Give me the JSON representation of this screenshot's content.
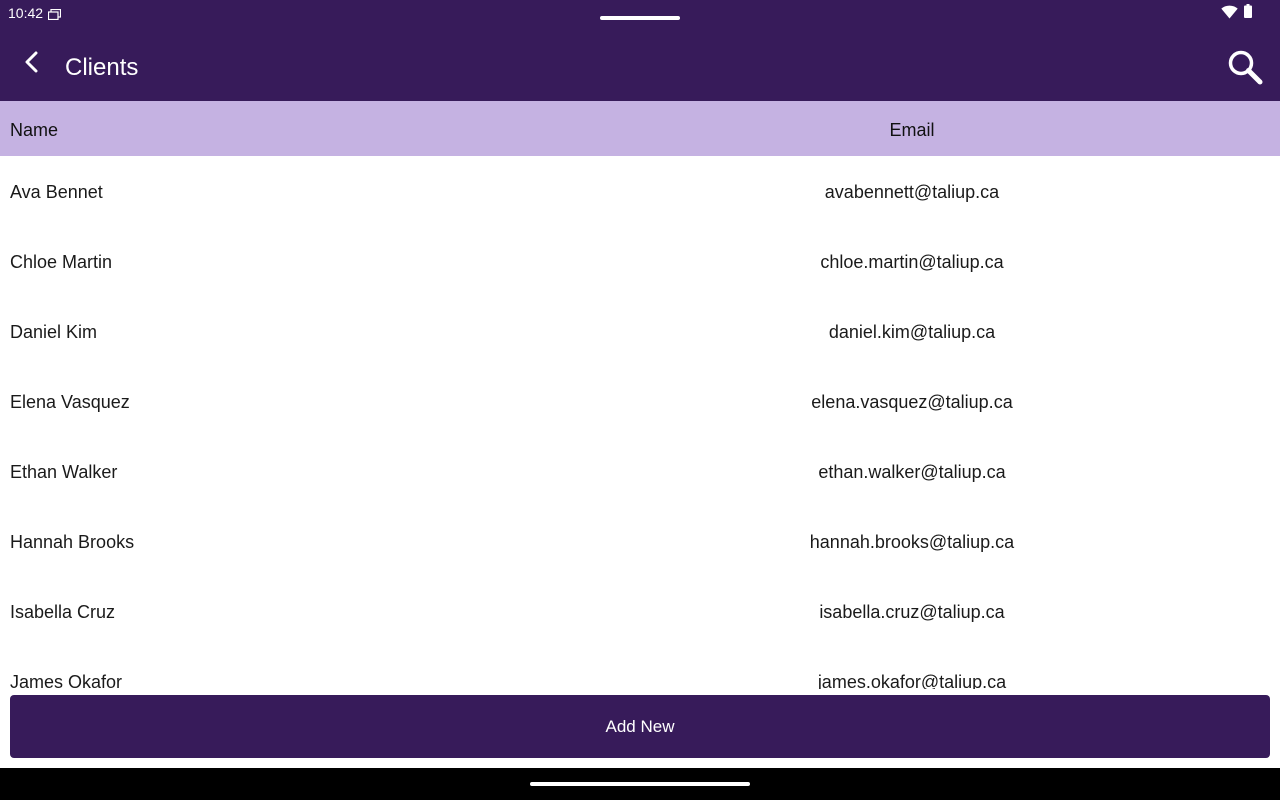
{
  "status_bar": {
    "time": "10:42",
    "icons": [
      "notification-icon",
      "wifi-icon",
      "battery-icon"
    ]
  },
  "app_bar": {
    "title": "Clients",
    "back_icon": "chevron-left-icon",
    "search_icon": "search-icon"
  },
  "table": {
    "headers": {
      "name": "Name",
      "email": "Email"
    },
    "rows": [
      {
        "name": "Ava Bennet",
        "email": "avabennett@taliup.ca"
      },
      {
        "name": "Chloe Martin",
        "email": "chloe.martin@taliup.ca"
      },
      {
        "name": "Daniel Kim",
        "email": "daniel.kim@taliup.ca"
      },
      {
        "name": "Elena Vasquez",
        "email": "elena.vasquez@taliup.ca"
      },
      {
        "name": "Ethan Walker",
        "email": "ethan.walker@taliup.ca"
      },
      {
        "name": "Hannah Brooks",
        "email": "hannah.brooks@taliup.ca"
      },
      {
        "name": "Isabella Cruz",
        "email": "isabella.cruz@taliup.ca"
      },
      {
        "name": "James Okafor",
        "email": "james.okafor@taliup.ca"
      }
    ]
  },
  "footer": {
    "add_label": "Add New"
  },
  "colors": {
    "primary": "#371b5a",
    "header_bg": "#c5b2e2",
    "on_primary": "#ffffff"
  }
}
